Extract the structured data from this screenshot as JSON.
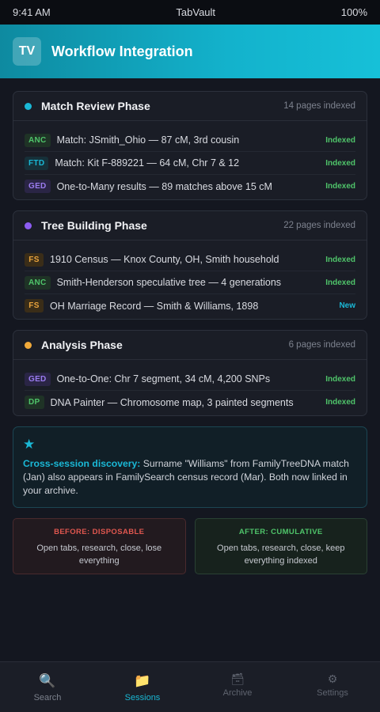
{
  "status_bar": {
    "time": "9:41 AM",
    "app": "TabVault",
    "battery": "100%"
  },
  "header": {
    "logo_text": "TV",
    "title": "Workflow Integration"
  },
  "phases": [
    {
      "title": "Match Review Phase",
      "count": "14 pages indexed",
      "dot_color": "#1ab8d6",
      "rows": [
        {
          "badge": "ANC",
          "badge_color": "#4fc46a",
          "badge_bg": "#1f3326",
          "text": "Match: JSmith_Ohio — 87 cM, 3rd cousin",
          "status": "Indexed",
          "status_color": "#4fc46a"
        },
        {
          "badge": "FTD",
          "badge_color": "#1ab8d6",
          "badge_bg": "#163039",
          "text": "Match: Kit F-889221 — 64 cM, Chr 7 & 12",
          "status": "Indexed",
          "status_color": "#4fc46a"
        },
        {
          "badge": "GED",
          "badge_color": "#9b7cf0",
          "badge_bg": "#2a2545",
          "text": "One-to-Many results — 89 matches above 15 cM",
          "status": "Indexed",
          "status_color": "#4fc46a"
        }
      ]
    },
    {
      "title": "Tree Building Phase",
      "count": "22 pages indexed",
      "dot_color": "#8c5cf2",
      "rows": [
        {
          "badge": "FS",
          "badge_color": "#e8a33d",
          "badge_bg": "#3a2d18",
          "text": "1910 Census — Knox County, OH, Smith household",
          "status": "Indexed",
          "status_color": "#4fc46a"
        },
        {
          "badge": "ANC",
          "badge_color": "#4fc46a",
          "badge_bg": "#1f3326",
          "text": "Smith-Henderson speculative tree — 4 generations",
          "status": "Indexed",
          "status_color": "#4fc46a"
        },
        {
          "badge": "FS",
          "badge_color": "#e8a33d",
          "badge_bg": "#3a2d18",
          "text": "OH Marriage Record — Smith & Williams, 1898",
          "status": "New",
          "status_color": "#1ab8d6"
        }
      ]
    },
    {
      "title": "Analysis Phase",
      "count": "6 pages indexed",
      "dot_color": "#f0a93a",
      "rows": [
        {
          "badge": "GED",
          "badge_color": "#9b7cf0",
          "badge_bg": "#2a2545",
          "text": "One-to-One: Chr 7 segment, 34 cM, 4,200 SNPs",
          "status": "Indexed",
          "status_color": "#4fc46a"
        },
        {
          "badge": "DP",
          "badge_color": "#4fc46a",
          "badge_bg": "#1f3326",
          "text": "DNA Painter — Chromosome map, 3 painted segments",
          "status": "Indexed",
          "status_color": "#4fc46a"
        }
      ]
    }
  ],
  "discovery": {
    "icon": "star-icon",
    "lead": "Cross-session discovery:",
    "text": " Surname \"Williams\" from FamilyTreeDNA match (Jan) also appears in FamilySearch census record (Mar). Both now linked in your archive."
  },
  "compare": {
    "before": {
      "title": "BEFORE: DISPOSABLE",
      "body": "Open tabs, research, close, lose everything"
    },
    "after": {
      "title": "AFTER: CUMULATIVE",
      "body": "Open tabs, research, close, keep everything indexed"
    }
  },
  "tabs": [
    {
      "label": "Search",
      "icon": "magnifier-icon",
      "glyph": "🔍"
    },
    {
      "label": "Sessions",
      "icon": "folder-icon",
      "glyph": "📁",
      "active": true
    },
    {
      "label": "Archive",
      "icon": "card-box-icon",
      "glyph": "🗃"
    },
    {
      "label": "Settings",
      "icon": "gear-icon",
      "glyph": "⚙"
    }
  ]
}
